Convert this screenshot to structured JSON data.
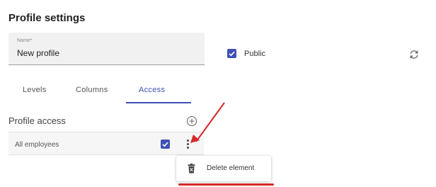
{
  "header": {
    "title": "Profile settings"
  },
  "name_field": {
    "label": "Name*",
    "value": "New profile"
  },
  "public_toggle": {
    "label": "Public",
    "checked": true
  },
  "tabs": [
    {
      "label": "Levels",
      "active": false
    },
    {
      "label": "Columns",
      "active": false
    },
    {
      "label": "Access",
      "active": true
    }
  ],
  "profile_access": {
    "title": "Profile access",
    "rows": [
      {
        "label": "All employees",
        "checked": true
      }
    ]
  },
  "context_menu": {
    "items": [
      {
        "label": "Delete element",
        "icon": "trash-icon"
      }
    ]
  },
  "colors": {
    "accent": "#3f51b5",
    "annotation": "#d62828"
  }
}
